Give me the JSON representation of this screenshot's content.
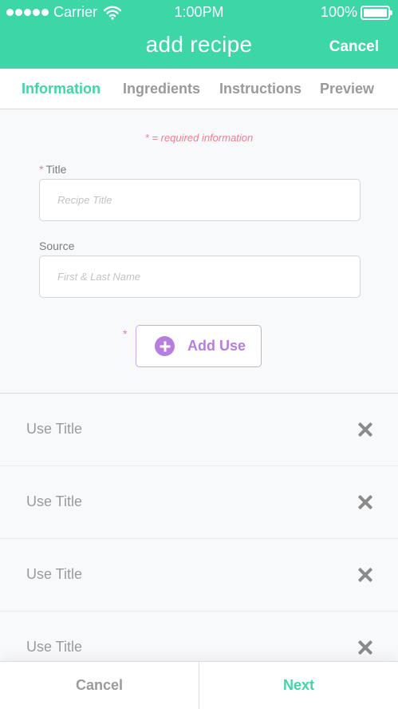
{
  "status_bar": {
    "carrier": "Carrier",
    "time": "1:00PM",
    "battery": "100%",
    "battery_level": 1.0
  },
  "nav": {
    "title": "add recipe",
    "cancel_label": "Cancel"
  },
  "tabs": [
    {
      "label": "Information",
      "active": true
    },
    {
      "label": "Ingredients",
      "active": false
    },
    {
      "label": "Instructions",
      "active": false
    },
    {
      "label": "Preview",
      "active": false
    }
  ],
  "form": {
    "required_note": "* = required information",
    "title_label": "Title",
    "title_placeholder": "Recipe Title",
    "source_label": "Source",
    "source_placeholder": "First & Last Name",
    "required_marker": "*",
    "add_use_label": "Add Use"
  },
  "uses": [
    {
      "title": "Use Title"
    },
    {
      "title": "Use Title"
    },
    {
      "title": "Use Title"
    },
    {
      "title": "Use Title"
    }
  ],
  "bottom": {
    "cancel_label": "Cancel",
    "next_label": "Next"
  },
  "colors": {
    "accent": "#3dd6a7",
    "purple": "#b57edf",
    "required": "#f07d8f"
  },
  "icons": [
    "wifi-icon",
    "battery-icon",
    "plus-circle-icon",
    "close-icon"
  ]
}
